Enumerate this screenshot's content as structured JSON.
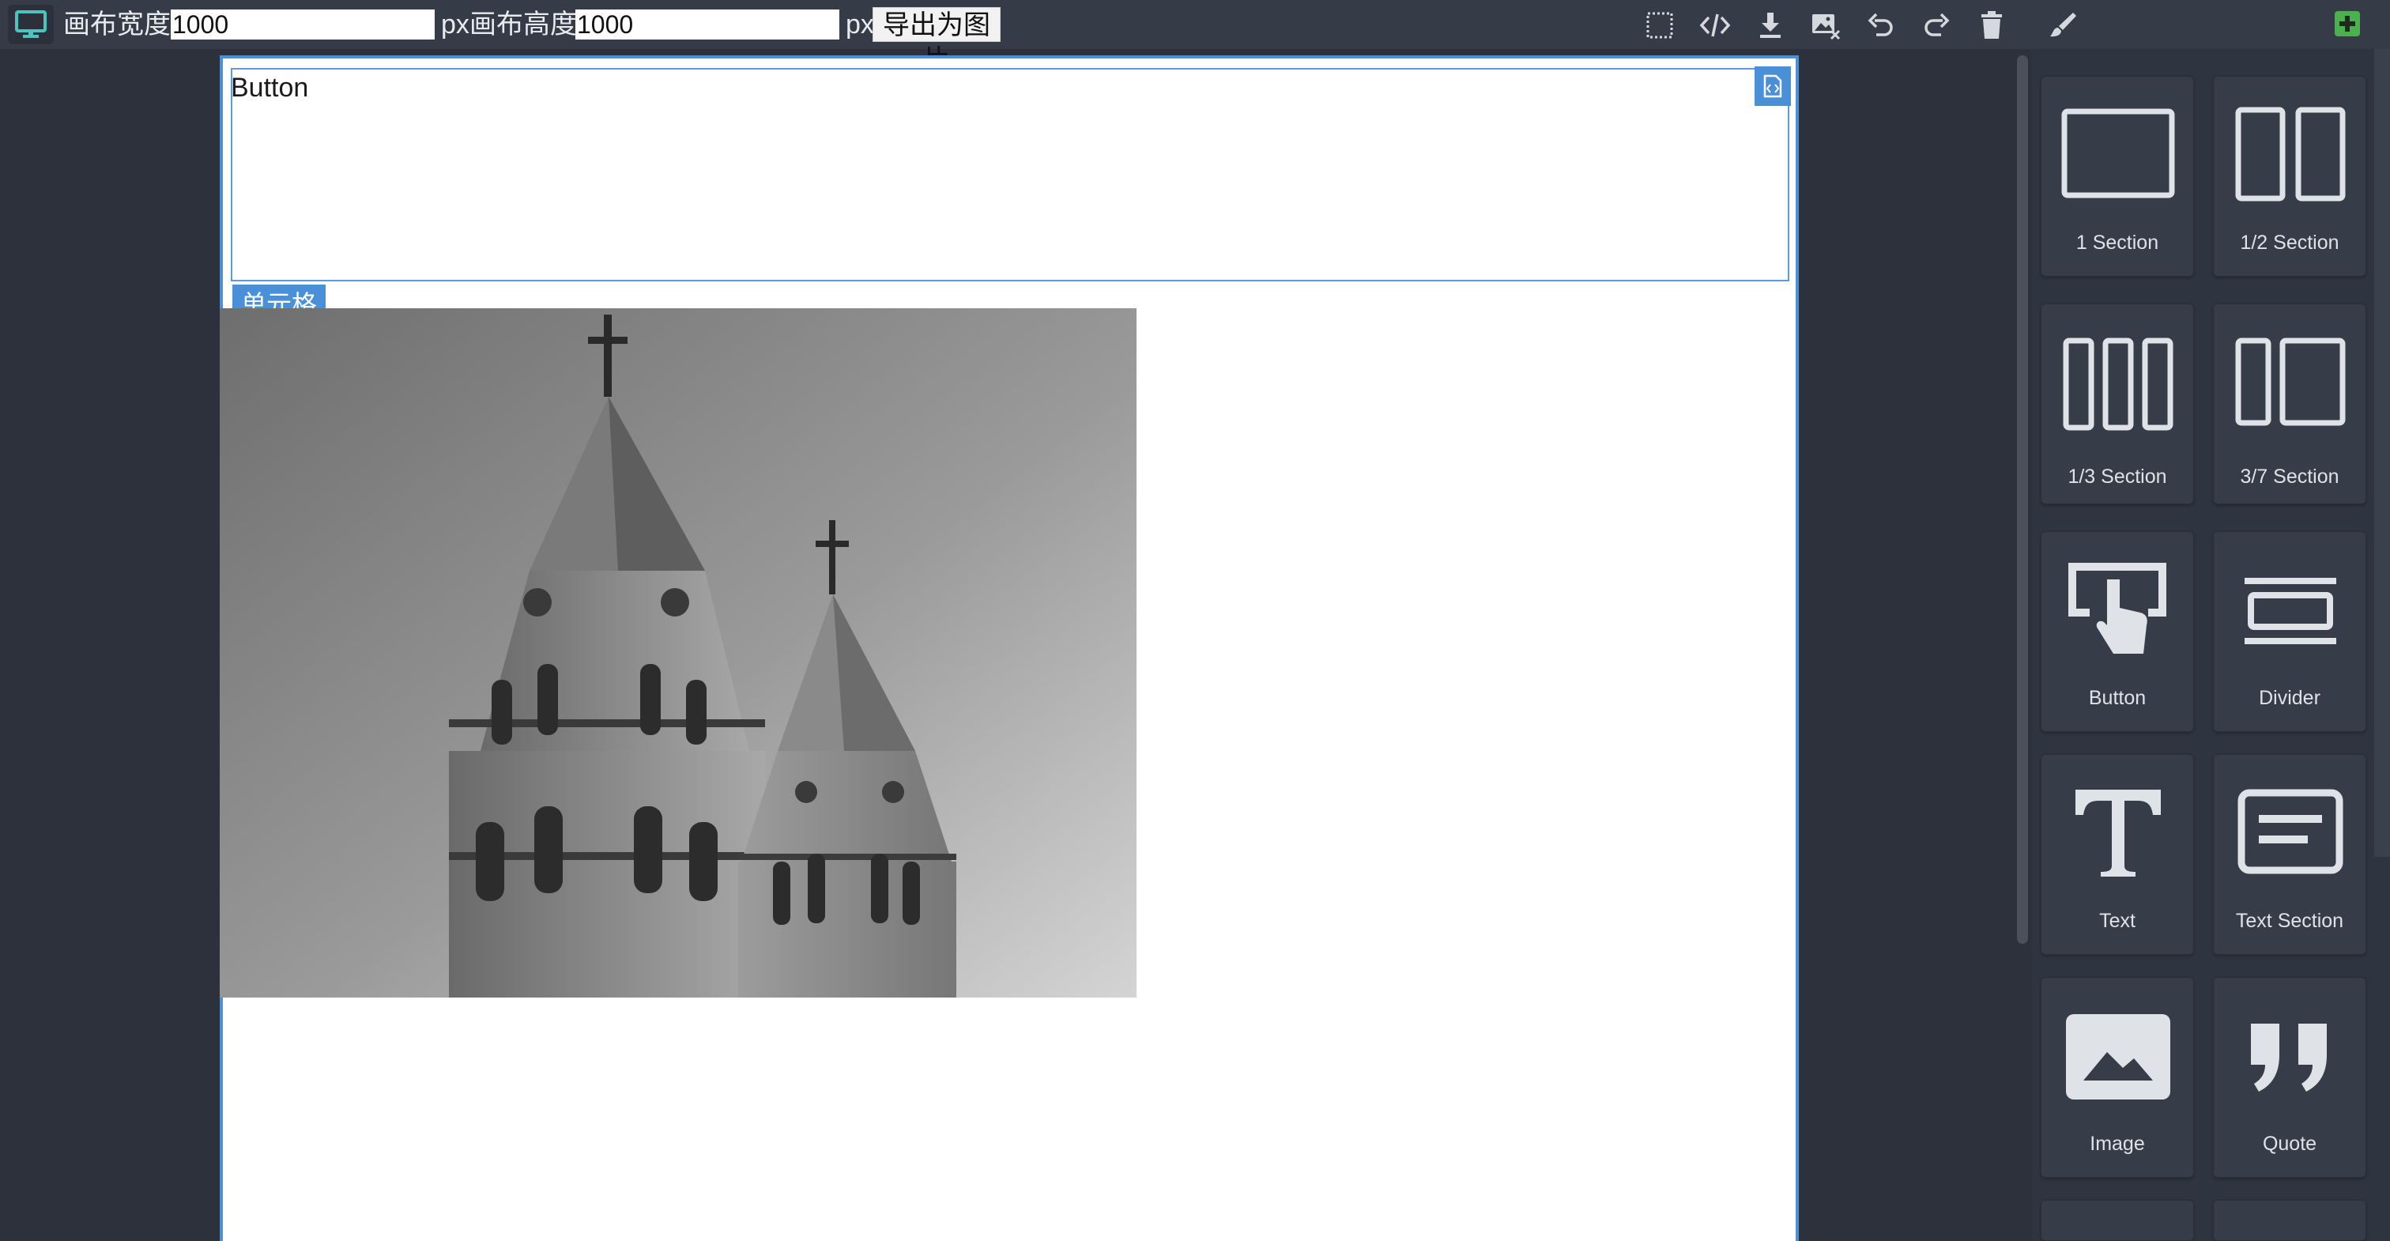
{
  "toolbar": {
    "device_icon": "monitor-icon",
    "canvas_width_label": "画布宽度",
    "canvas_width_value": "1000",
    "unit_px": "px",
    "canvas_height_label": "画布高度",
    "canvas_height_value": "1000",
    "export_label": "导出为图片",
    "actions": [
      {
        "icon": "select-area-icon"
      },
      {
        "icon": "code-icon"
      },
      {
        "icon": "download-icon"
      },
      {
        "icon": "remove-image-icon"
      },
      {
        "icon": "undo-icon"
      },
      {
        "icon": "redo-icon"
      },
      {
        "icon": "trash-icon"
      },
      {
        "icon": "paintbrush-icon"
      },
      {
        "icon": "add-block-icon"
      }
    ],
    "accent_color": "#4a90d9",
    "icon_color": "#d5d9de",
    "add_icon_color": "#4caf50"
  },
  "canvas": {
    "button_text": "Button",
    "cell_badge": "单元格",
    "code_badge_icon": "code-file-icon",
    "image": "church-towers-photo"
  },
  "blocks": [
    {
      "label": "1 Section",
      "icon": "one-section-icon"
    },
    {
      "label": "1/2 Section",
      "icon": "half-section-icon"
    },
    {
      "label": "1/3 Section",
      "icon": "third-section-icon"
    },
    {
      "label": "3/7 Section",
      "icon": "three-seven-section-icon"
    },
    {
      "label": "Button",
      "icon": "button-pointer-icon"
    },
    {
      "label": "Divider",
      "icon": "divider-icon"
    },
    {
      "label": "Text",
      "icon": "text-icon"
    },
    {
      "label": "Text Section",
      "icon": "text-section-icon"
    },
    {
      "label": "Image",
      "icon": "image-icon"
    },
    {
      "label": "Quote",
      "icon": "quote-icon"
    }
  ]
}
